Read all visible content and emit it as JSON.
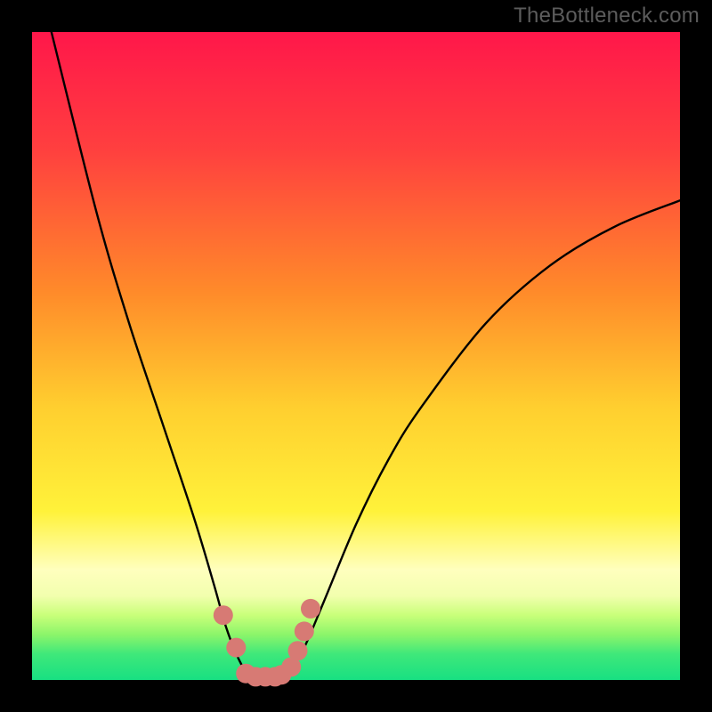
{
  "watermark": "TheBottleneck.com",
  "chart_data": {
    "type": "line",
    "title": "",
    "xlabel": "",
    "ylabel": "",
    "xlim": [
      0,
      100
    ],
    "ylim": [
      0,
      100
    ],
    "grid": false,
    "legend": false,
    "series_main": {
      "name": "bottleneck-curve",
      "note": "V-shaped curve; y ≈ 0 at x ≈ 33–40 (the notch), rising steeply on both sides",
      "x": [
        3,
        10,
        15,
        20,
        25,
        28,
        30,
        32,
        34,
        36,
        38,
        40,
        42,
        45,
        50,
        55,
        60,
        70,
        80,
        90,
        100
      ],
      "y": [
        100,
        72,
        55,
        40,
        25,
        15,
        8,
        3,
        0,
        0,
        0,
        2,
        5,
        12,
        24,
        34,
        42,
        55,
        64,
        70,
        74
      ]
    },
    "highlight_points": {
      "name": "highlight-dots",
      "color": "#d77a74",
      "note": "Thick salmon dots along the bottom of the notch",
      "x": [
        29.5,
        31.5,
        33.0,
        34.5,
        36.0,
        37.5,
        38.5,
        40.0,
        41.0,
        42.0,
        43.0
      ],
      "y": [
        10.0,
        5.0,
        1.0,
        0.5,
        0.5,
        0.5,
        0.8,
        2.0,
        4.5,
        7.5,
        11.0
      ]
    },
    "background_gradient": {
      "top_color": "#ff1a4d",
      "mid_color": "#ffe33b",
      "green_band_top": "#ddff5a",
      "green_band_bottom": "#18e87b",
      "stops_approx_pct": [
        0,
        45,
        82,
        90,
        95,
        100
      ]
    }
  }
}
